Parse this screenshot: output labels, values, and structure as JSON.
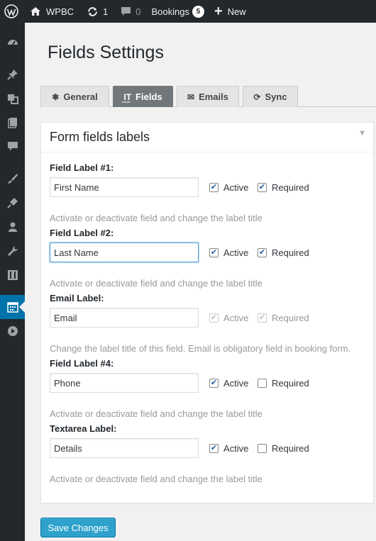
{
  "adminbar": {
    "site_name": "WPBC",
    "updates_count": "1",
    "comments_count": "0",
    "bookings_label": "Bookings",
    "bookings_badge": "5",
    "new_label": "New"
  },
  "page": {
    "title": "Fields Settings",
    "tabs": [
      {
        "label": "General",
        "icon": "asterisk-icon"
      },
      {
        "label": "Fields",
        "icon": "text-cursor-icon"
      },
      {
        "label": "Emails",
        "icon": "envelope-icon"
      },
      {
        "label": "Sync",
        "icon": "sync-icon"
      }
    ],
    "active_tab": "Fields"
  },
  "panel": {
    "title": "Form fields labels",
    "active_label": "Active",
    "required_label": "Required",
    "fields": [
      {
        "label": "Field Label #1:",
        "value": "First Name",
        "active": true,
        "required": true,
        "disabled": false,
        "help": "Activate or deactivate field and change the label title"
      },
      {
        "label": "Field Label #2:",
        "value": "Last Name",
        "active": true,
        "required": true,
        "disabled": false,
        "help": "Activate or deactivate field and change the label title"
      },
      {
        "label": "Email Label:",
        "value": "Email",
        "active": true,
        "required": true,
        "disabled": true,
        "help": "Change the label title of this field. Email is obligatory field in booking form."
      },
      {
        "label": "Field Label #4:",
        "value": "Phone",
        "active": true,
        "required": false,
        "disabled": false,
        "help": "Activate or deactivate field and change the label title"
      },
      {
        "label": "Textarea Label:",
        "value": "Details",
        "active": true,
        "required": false,
        "disabled": false,
        "help": "Activate or deactivate field and change the label title"
      }
    ]
  },
  "actions": {
    "save_label": "Save Changes"
  },
  "colors": {
    "adminbar_bg": "#23282d",
    "accent": "#0073aa",
    "button": "#2ea2cc",
    "active_tab": "#72777c"
  }
}
